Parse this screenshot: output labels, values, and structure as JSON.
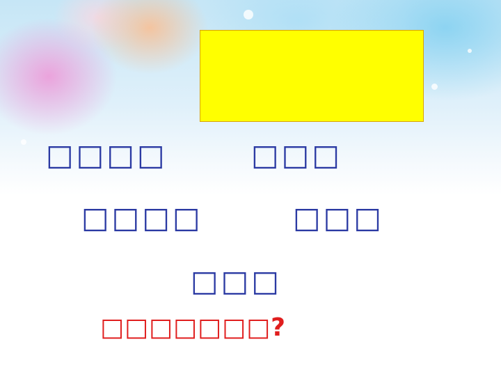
{
  "slide": {
    "line1_left": "□□□□",
    "line1_right": "□□□",
    "line2_left": "□□□□",
    "line2_right": "□□□",
    "line3": "□□□",
    "question": "□□□□□□□?"
  },
  "colors": {
    "box_fill": "#ffff00",
    "text_blue": "#2b3aa3",
    "question_red": "#e01e1e"
  }
}
